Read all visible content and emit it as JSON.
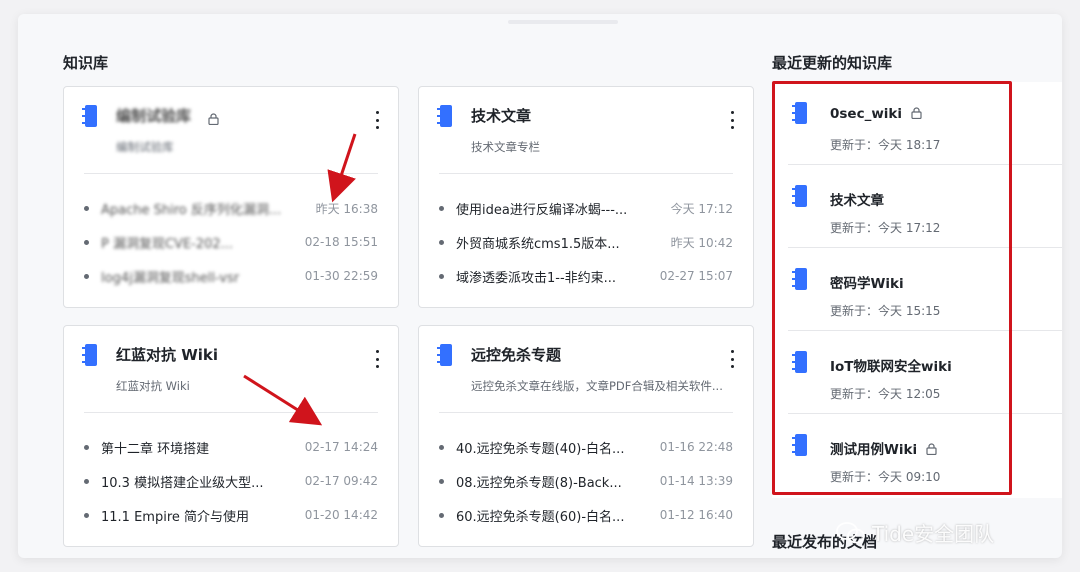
{
  "colors": {
    "accent": "#3370ff",
    "highlight": "#d0141c",
    "arrow": "#d0141c"
  },
  "sections": {
    "library": "知识库",
    "recent_updated": "最近更新的知识库",
    "recent_published": "最近发布的文档"
  },
  "cards": [
    {
      "title": "编制试验库",
      "title_blurred": true,
      "locked": true,
      "desc": "编制试验库",
      "desc_blurred": true,
      "items": [
        {
          "title": "Apache Shiro 反序列化漏洞...",
          "time": "昨天 16:38",
          "blurred": true
        },
        {
          "title": "P 漏洞复现CVE-202...",
          "time": "02-18 15:51",
          "blurred": true
        },
        {
          "title": "log4j漏洞复现shell-vsr",
          "time": "01-30 22:59",
          "blurred": true
        }
      ]
    },
    {
      "title": "技术文章",
      "desc": "技术文章专栏",
      "items": [
        {
          "title": "使用idea进行反编译冰蝎---...",
          "time": "今天 17:12"
        },
        {
          "title": "外贸商城系统cms1.5版本...",
          "time": "昨天 10:42"
        },
        {
          "title": "域渗透委派攻击1--非约束...",
          "time": "02-27 15:07"
        }
      ]
    },
    {
      "title": "红蓝对抗 Wiki",
      "desc": "红蓝对抗 Wiki",
      "items": [
        {
          "title": "第十二章 环境搭建",
          "time": "02-17 14:24"
        },
        {
          "title": "10.3 模拟搭建企业级大型...",
          "time": "02-17 09:42"
        },
        {
          "title": "11.1 Empire 简介与使用",
          "time": "01-20 14:42"
        }
      ]
    },
    {
      "title": "远控免杀专题",
      "desc": "远控免杀文章在线版，文章PDF合辑及相关软件...",
      "items": [
        {
          "title": "40.远控免杀专题(40)-白名...",
          "time": "01-16 22:48"
        },
        {
          "title": "08.远控免杀专题(8)-Back...",
          "time": "01-14 13:39"
        },
        {
          "title": "60.远控免杀专题(60)-白名...",
          "time": "01-12 16:40"
        }
      ]
    }
  ],
  "recent": [
    {
      "title": "0sec_wiki",
      "locked": true,
      "updated": "更新于：今天 18:17"
    },
    {
      "title": "技术文章",
      "locked": false,
      "updated": "更新于：今天 17:12"
    },
    {
      "title": "密码学Wiki",
      "locked": false,
      "updated": "更新于：今天 15:15"
    },
    {
      "title": "IoT物联网安全wiki",
      "locked": false,
      "updated": "更新于：今天 12:05"
    },
    {
      "title": "测试用例Wiki",
      "locked": true,
      "updated": "更新于：今天 09:10"
    }
  ],
  "watermark": "Tide安全团队"
}
